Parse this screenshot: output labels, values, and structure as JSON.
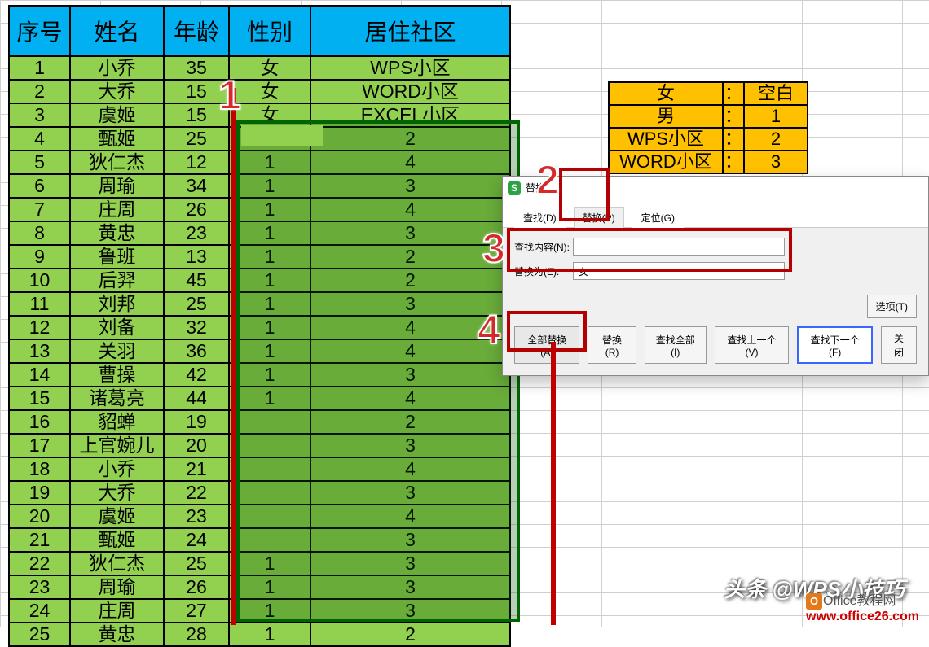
{
  "table": {
    "headers": [
      "序号",
      "姓名",
      "年龄",
      "性别",
      "居住社区"
    ],
    "rows": [
      {
        "no": "1",
        "name": "小乔",
        "age": "35",
        "sex": "女",
        "area": "WPS小区"
      },
      {
        "no": "2",
        "name": "大乔",
        "age": "15",
        "sex": "女",
        "area": "WORD小区"
      },
      {
        "no": "3",
        "name": "虞姬",
        "age": "15",
        "sex": "女",
        "area": "EXCEL小区"
      },
      {
        "no": "4",
        "name": "甄姬",
        "age": "25",
        "sex": "",
        "area": "2"
      },
      {
        "no": "5",
        "name": "狄仁杰",
        "age": "12",
        "sex": "1",
        "area": "4"
      },
      {
        "no": "6",
        "name": "周瑜",
        "age": "34",
        "sex": "1",
        "area": "3"
      },
      {
        "no": "7",
        "name": "庄周",
        "age": "26",
        "sex": "1",
        "area": "4"
      },
      {
        "no": "8",
        "name": "黄忠",
        "age": "23",
        "sex": "1",
        "area": "3"
      },
      {
        "no": "9",
        "name": "鲁班",
        "age": "13",
        "sex": "1",
        "area": "2"
      },
      {
        "no": "10",
        "name": "后羿",
        "age": "45",
        "sex": "1",
        "area": "2"
      },
      {
        "no": "11",
        "name": "刘邦",
        "age": "25",
        "sex": "1",
        "area": "3"
      },
      {
        "no": "12",
        "name": "刘备",
        "age": "32",
        "sex": "1",
        "area": "4"
      },
      {
        "no": "13",
        "name": "关羽",
        "age": "36",
        "sex": "1",
        "area": "4"
      },
      {
        "no": "14",
        "name": "曹操",
        "age": "42",
        "sex": "1",
        "area": "3"
      },
      {
        "no": "15",
        "name": "诸葛亮",
        "age": "44",
        "sex": "1",
        "area": "4"
      },
      {
        "no": "16",
        "name": "貂蝉",
        "age": "19",
        "sex": "",
        "area": "2"
      },
      {
        "no": "17",
        "name": "上官婉儿",
        "age": "20",
        "sex": "",
        "area": "3"
      },
      {
        "no": "18",
        "name": "小乔",
        "age": "21",
        "sex": "",
        "area": "4"
      },
      {
        "no": "19",
        "name": "大乔",
        "age": "22",
        "sex": "",
        "area": "3"
      },
      {
        "no": "20",
        "name": "虞姬",
        "age": "23",
        "sex": "",
        "area": "4"
      },
      {
        "no": "21",
        "name": "甄姬",
        "age": "24",
        "sex": "",
        "area": "3"
      },
      {
        "no": "22",
        "name": "狄仁杰",
        "age": "25",
        "sex": "1",
        "area": "3"
      },
      {
        "no": "23",
        "name": "周瑜",
        "age": "26",
        "sex": "1",
        "area": "3"
      },
      {
        "no": "24",
        "name": "庄周",
        "age": "27",
        "sex": "1",
        "area": "3"
      },
      {
        "no": "25",
        "name": "黄忠",
        "age": "28",
        "sex": "1",
        "area": "2"
      }
    ]
  },
  "legend": {
    "rows": [
      {
        "k": "女",
        "s": "：",
        "v": "空白"
      },
      {
        "k": "男",
        "s": "：",
        "v": "1"
      },
      {
        "k": "WPS小区",
        "s": "：",
        "v": "2"
      },
      {
        "k": "WORD小区",
        "s": "：",
        "v": "3"
      }
    ]
  },
  "dialog": {
    "title": "替换",
    "icon_letter": "S",
    "tabs": {
      "find": "查找(D)",
      "replace": "替换(P)",
      "goto": "定位(G)"
    },
    "find_label": "查找内容(N):",
    "find_value": "",
    "replace_label": "替换为(E):",
    "replace_value": "女",
    "options_btn": "选项(T)",
    "buttons": {
      "replace_all": "全部替换(A)",
      "replace": "替换(R)",
      "find_all": "查找全部(I)",
      "find_prev": "查找上一个(V)",
      "find_next": "查找下一个(F)",
      "close": "关闭"
    }
  },
  "callouts": {
    "n1": "1",
    "n2": "2",
    "n3": "3",
    "n4": "4"
  },
  "watermark": {
    "top": "头条 @WPS小技巧",
    "site_prefix": "Office教程网",
    "site": "www.office26.com"
  }
}
